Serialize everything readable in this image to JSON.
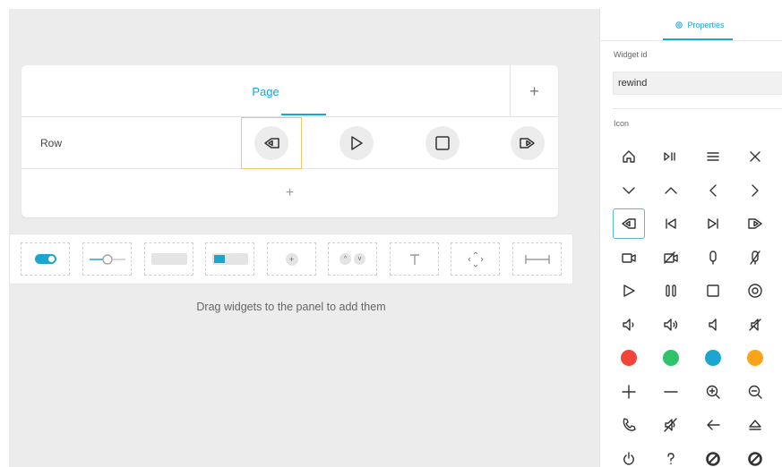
{
  "editor": {
    "page_tab_label": "Page",
    "add_page_label": "+",
    "row_label": "Row",
    "add_row_label": "+",
    "row_widgets": [
      {
        "icon": "rewind-icon",
        "selected": true
      },
      {
        "icon": "play-icon",
        "selected": false
      },
      {
        "icon": "stop-icon",
        "selected": false
      },
      {
        "icon": "fast-forward-icon",
        "selected": false
      }
    ]
  },
  "palette": {
    "items": [
      "toggle-widget",
      "slider-widget",
      "button-widget",
      "group-button-widget",
      "spinner-widget",
      "spinner-arrows-widget",
      "text-widget",
      "directional-pad-widget",
      "spacer-widget"
    ],
    "hint": "Drag widgets to the panel to add them"
  },
  "properties": {
    "tab_label": "Properties",
    "widget_id_label": "Widget id",
    "widget_id_value": "rewind",
    "icon_label": "Icon",
    "selected_icon": "rewind-icon",
    "icons": [
      "home-icon",
      "play-pause-icon",
      "list-icon",
      "close-icon",
      "chevron-down-icon",
      "chevron-up-icon",
      "chevron-left-icon",
      "chevron-right-icon",
      "rewind-icon",
      "skip-back-icon",
      "skip-forward-icon",
      "fast-forward-icon",
      "camera-icon",
      "camera-off-icon",
      "microphone-icon",
      "microphone-off-icon",
      "play-icon",
      "pause-icon",
      "stop-icon",
      "record-icon",
      "volume-down-icon",
      "volume-up-icon",
      "speaker-icon",
      "mute-icon",
      "red-dot-icon",
      "green-dot-icon",
      "blue-dot-icon",
      "orange-dot-icon",
      "plus-icon",
      "minus-icon",
      "zoom-in-icon",
      "zoom-out-icon",
      "phone-icon",
      "speaker-mute-icon",
      "arrow-left-icon",
      "eject-icon",
      "power-icon",
      "help-icon",
      "disc-icon",
      "disc-alt-icon"
    ],
    "colors": {
      "red": "#f0453a",
      "green": "#2fc36b",
      "blue": "#1ba6d2",
      "orange": "#fba41a"
    }
  }
}
